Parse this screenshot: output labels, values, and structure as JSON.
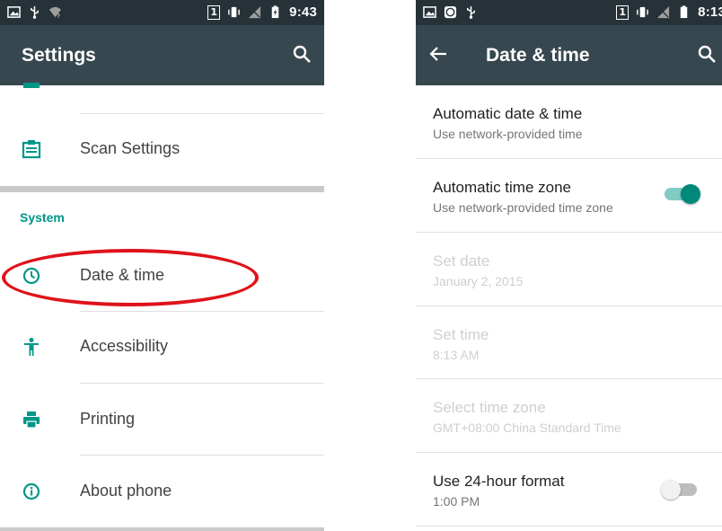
{
  "left": {
    "status": {
      "time": "9:43",
      "sim_slot": "1"
    },
    "appbar": {
      "title": "Settings"
    },
    "items": [
      {
        "label": "Scan Settings"
      },
      {
        "label": "Date & time"
      },
      {
        "label": "Accessibility"
      },
      {
        "label": "Printing"
      },
      {
        "label": "About phone"
      }
    ],
    "section_header": "System"
  },
  "right": {
    "status": {
      "time": "8:13",
      "sim_slot": "1"
    },
    "appbar": {
      "title": "Date & time"
    },
    "prefs": [
      {
        "title": "Automatic date & time",
        "summary": "Use network-provided time"
      },
      {
        "title": "Automatic time zone",
        "summary": "Use network-provided time zone",
        "switch": "on"
      },
      {
        "title": "Set date",
        "summary": "January 2, 2015",
        "disabled": true
      },
      {
        "title": "Set time",
        "summary": "8:13 AM",
        "disabled": true
      },
      {
        "title": "Select time zone",
        "summary": "GMT+08:00 China Standard Time",
        "disabled": true
      },
      {
        "title": "Use 24-hour format",
        "summary": "1:00 PM",
        "switch": "off"
      }
    ]
  },
  "colors": {
    "accent": "#009688",
    "appbar": "#37474f",
    "statusbar": "#263238",
    "highlight": "#e0121a"
  }
}
